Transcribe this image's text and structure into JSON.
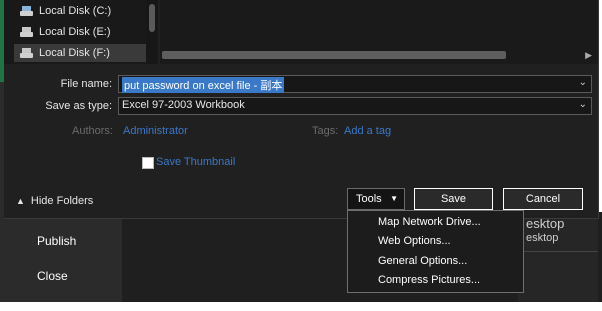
{
  "tree": {
    "items": [
      {
        "label": "Local Disk (C:)",
        "icon": "local-disk-c-icon"
      },
      {
        "label": "Local Disk (E:)",
        "icon": "disk-icon"
      },
      {
        "label": "Local Disk (F:)",
        "icon": "disk-icon"
      }
    ]
  },
  "form": {
    "file_name_label": "File name:",
    "file_name_value": "put password on excel file - 副本",
    "save_type_label": "Save as type:",
    "save_type_value": "Excel 97-2003 Workbook"
  },
  "meta": {
    "authors_label": "Authors:",
    "authors_value": "Administrator",
    "tags_label": "Tags:",
    "tags_value": "Add a tag",
    "thumbnail_label": "Save Thumbnail"
  },
  "footer": {
    "hide_folders_label": "Hide Folders",
    "tools_label": "Tools",
    "save_label": "Save",
    "cancel_label": "Cancel"
  },
  "tools_menu": {
    "items": [
      "Map Network Drive...",
      "Web Options...",
      "General Options...",
      "Compress Pictures..."
    ]
  },
  "backstage": {
    "items": [
      "Publish",
      "Close"
    ]
  },
  "background_card": {
    "title": "esktop",
    "subtitle": "esktop"
  },
  "colors": {
    "accent": "#217346",
    "link": "#3a78c8",
    "selection": "#3a78c8"
  }
}
